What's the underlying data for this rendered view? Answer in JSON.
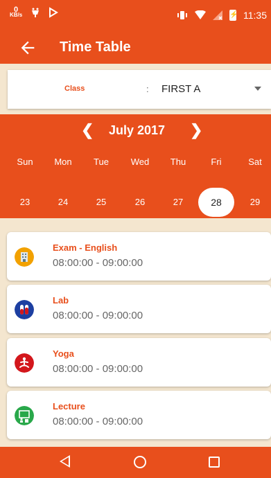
{
  "status_bar": {
    "net_speed_value": "0",
    "net_speed_unit": "KB/s",
    "time": "11:35"
  },
  "app_bar": {
    "title": "Time Table",
    "back_icon": "arrow-left-icon"
  },
  "class_selector": {
    "label": "Class",
    "colon": ":",
    "value": "FIRST A"
  },
  "calendar": {
    "month": "July 2017",
    "prev_glyph": "❮",
    "next_glyph": "❯",
    "day_names": [
      "Sun",
      "Mon",
      "Tue",
      "Wed",
      "Thu",
      "Fri",
      "Sat"
    ],
    "dates": [
      "23",
      "24",
      "25",
      "26",
      "27",
      "28",
      "29"
    ],
    "selected_date": "28"
  },
  "schedule": [
    {
      "title": "Exam - English",
      "time": "08:00:00 - 09:00:00",
      "icon": "building-icon",
      "icon_color": "#f2a100"
    },
    {
      "title": "Lab",
      "time": "08:00:00 - 09:00:00",
      "icon": "test-tubes-icon",
      "icon_color": "#1d3fa1"
    },
    {
      "title": "Yoga",
      "time": "08:00:00 - 09:00:00",
      "icon": "yoga-icon",
      "icon_color": "#d3171c"
    },
    {
      "title": "Lecture",
      "time": "08:00:00 - 09:00:00",
      "icon": "lecture-board-icon",
      "icon_color": "#29a84a"
    }
  ],
  "colors": {
    "primary": "#e84f1c",
    "background": "#f4e6cf"
  }
}
